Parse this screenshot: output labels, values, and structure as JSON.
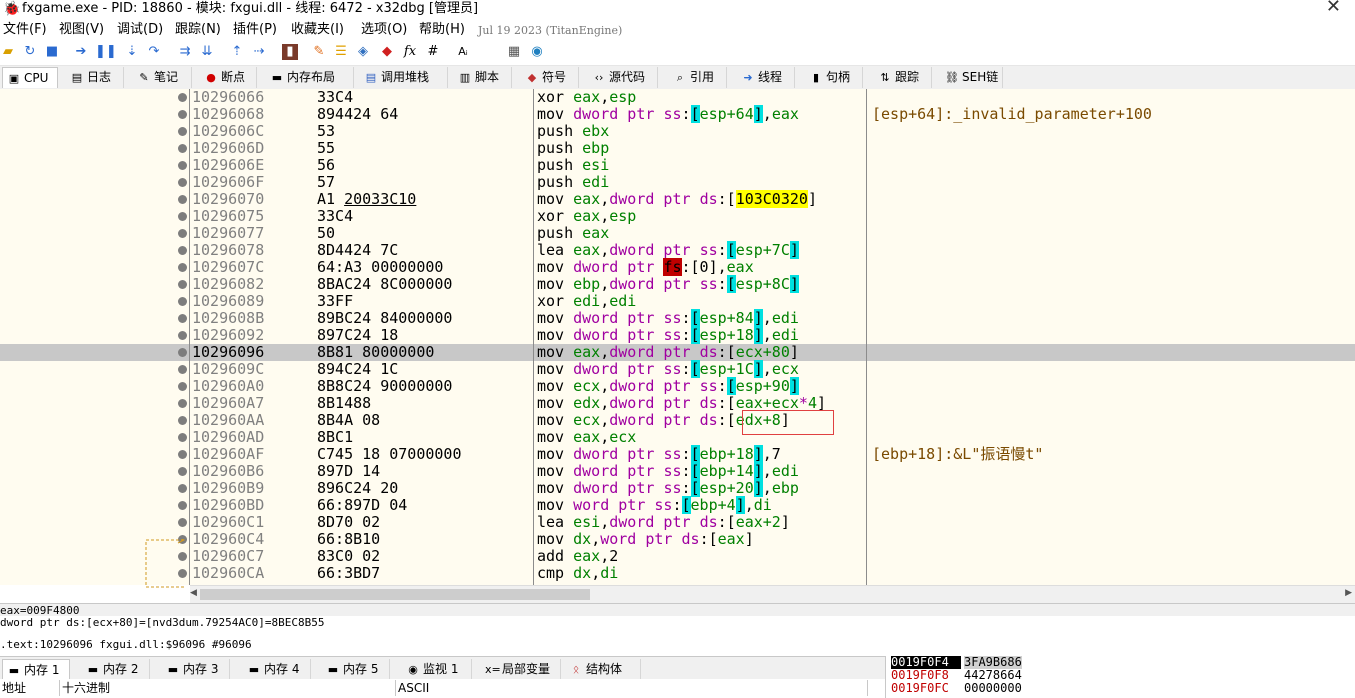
{
  "window": {
    "title": "fxgame.exe - PID: 18860 - 模块: fxgui.dll - 线程: 6472 - x32dbg [管理员]",
    "close": "✕"
  },
  "menu": {
    "items": [
      "文件(F)",
      "视图(V)",
      "调试(D)",
      "跟踪(N)",
      "插件(P)",
      "收藏夹(I)",
      "选项(O)",
      "帮助(H)"
    ],
    "build_date": "Jul 19 2023 (TitanEngine)"
  },
  "toolbar": {
    "icons": [
      "open-icon",
      "restart-icon",
      "stop-icon",
      "run-icon",
      "pause-icon",
      "step-into-icon",
      "step-over-icon",
      "trace-into-icon",
      "trace-over-icon",
      "execute-till-return-icon",
      "run-to-user-code-icon",
      "scylla-icon",
      "patch-icon",
      "comment-icon",
      "label-icon",
      "bookmark-icon",
      "function-icon",
      "hash-icon",
      "font-icon",
      "calculator-icon",
      "globe-icon"
    ]
  },
  "tabs": [
    {
      "label": "CPU",
      "icon": "cpu-icon"
    },
    {
      "label": "日志",
      "icon": "log-icon"
    },
    {
      "label": "笔记",
      "icon": "notes-icon"
    },
    {
      "label": "断点",
      "icon": "breakpoint-icon"
    },
    {
      "label": "内存布局",
      "icon": "memory-map-icon"
    },
    {
      "label": "调用堆栈",
      "icon": "call-stack-icon"
    },
    {
      "label": "脚本",
      "icon": "script-icon"
    },
    {
      "label": "符号",
      "icon": "symbols-icon"
    },
    {
      "label": "源代码",
      "icon": "source-icon"
    },
    {
      "label": "引用",
      "icon": "references-icon"
    },
    {
      "label": "线程",
      "icon": "threads-icon"
    },
    {
      "label": "句柄",
      "icon": "handles-icon"
    },
    {
      "label": "跟踪",
      "icon": "trace-icon"
    },
    {
      "label": "SEH链",
      "icon": "seh-icon"
    }
  ],
  "disasm": [
    {
      "addr": "10296066",
      "bytes": "33C4",
      "ins": [
        [
          "mn",
          "xor "
        ],
        [
          "rg",
          "eax"
        ],
        [
          "nm",
          ","
        ],
        [
          "rg",
          "esp"
        ]
      ],
      "cmt": ""
    },
    {
      "addr": "10296068",
      "bytes": "894424 64",
      "ins": [
        [
          "mn",
          "mov "
        ],
        [
          "kw",
          "dword ptr "
        ],
        [
          "sg",
          "ss"
        ],
        [
          "nm",
          ":"
        ],
        [
          "br",
          "["
        ],
        [
          "rg",
          "esp+64"
        ],
        [
          "br",
          "]"
        ],
        [
          "nm",
          ","
        ],
        [
          "rg",
          "eax"
        ]
      ],
      "cmt": "[esp+64]:_invalid_parameter+100"
    },
    {
      "addr": "1029606C",
      "bytes": "53",
      "ins": [
        [
          "mn",
          "push "
        ],
        [
          "rg",
          "ebx"
        ]
      ],
      "cmt": ""
    },
    {
      "addr": "1029606D",
      "bytes": "55",
      "ins": [
        [
          "mn",
          "push "
        ],
        [
          "rg",
          "ebp"
        ]
      ],
      "cmt": ""
    },
    {
      "addr": "1029606E",
      "bytes": "56",
      "ins": [
        [
          "mn",
          "push "
        ],
        [
          "rg",
          "esi"
        ]
      ],
      "cmt": ""
    },
    {
      "addr": "1029606F",
      "bytes": "57",
      "ins": [
        [
          "mn",
          "push "
        ],
        [
          "rg",
          "edi"
        ]
      ],
      "cmt": ""
    },
    {
      "addr": "10296070",
      "bytes": "A1 20033C10",
      "ul": "20033C10",
      "ins": [
        [
          "mn",
          "mov "
        ],
        [
          "rg",
          "eax"
        ],
        [
          "nm",
          ","
        ],
        [
          "kw",
          "dword ptr "
        ],
        [
          "sg",
          "ds"
        ],
        [
          "nm",
          ":["
        ],
        [
          "hl",
          "103C0320"
        ],
        [
          "nm",
          "]"
        ]
      ],
      "cmt": ""
    },
    {
      "addr": "10296075",
      "bytes": "33C4",
      "ins": [
        [
          "mn",
          "xor "
        ],
        [
          "rg",
          "eax"
        ],
        [
          "nm",
          ","
        ],
        [
          "rg",
          "esp"
        ]
      ],
      "cmt": ""
    },
    {
      "addr": "10296077",
      "bytes": "50",
      "ins": [
        [
          "mn",
          "push "
        ],
        [
          "rg",
          "eax"
        ]
      ],
      "cmt": ""
    },
    {
      "addr": "10296078",
      "bytes": "8D4424 7C",
      "ins": [
        [
          "mn",
          "lea "
        ],
        [
          "rg",
          "eax"
        ],
        [
          "nm",
          ","
        ],
        [
          "kw",
          "dword ptr "
        ],
        [
          "sg",
          "ss"
        ],
        [
          "nm",
          ":"
        ],
        [
          "br",
          "["
        ],
        [
          "rg",
          "esp+7C"
        ],
        [
          "br",
          "]"
        ]
      ],
      "cmt": ""
    },
    {
      "addr": "1029607C",
      "bytes": "64:A3 00000000",
      "ins": [
        [
          "mn",
          "mov "
        ],
        [
          "kw",
          "dword ptr "
        ],
        [
          "fs",
          "fs"
        ],
        [
          "nm",
          ":[0],"
        ],
        [
          "rg",
          "eax"
        ]
      ],
      "cmt": ""
    },
    {
      "addr": "10296082",
      "bytes": "8BAC24 8C000000",
      "ins": [
        [
          "mn",
          "mov "
        ],
        [
          "rg",
          "ebp"
        ],
        [
          "nm",
          ","
        ],
        [
          "kw",
          "dword ptr "
        ],
        [
          "sg",
          "ss"
        ],
        [
          "nm",
          ":"
        ],
        [
          "br",
          "["
        ],
        [
          "rg",
          "esp+8C"
        ],
        [
          "br",
          "]"
        ]
      ],
      "cmt": ""
    },
    {
      "addr": "10296089",
      "bytes": "33FF",
      "ins": [
        [
          "mn",
          "xor "
        ],
        [
          "rg",
          "edi"
        ],
        [
          "nm",
          ","
        ],
        [
          "rg",
          "edi"
        ]
      ],
      "cmt": ""
    },
    {
      "addr": "1029608B",
      "bytes": "89BC24 84000000",
      "ins": [
        [
          "mn",
          "mov "
        ],
        [
          "kw",
          "dword ptr "
        ],
        [
          "sg",
          "ss"
        ],
        [
          "nm",
          ":"
        ],
        [
          "br",
          "["
        ],
        [
          "rg",
          "esp+84"
        ],
        [
          "br",
          "]"
        ],
        [
          "nm",
          ","
        ],
        [
          "rg",
          "edi"
        ]
      ],
      "cmt": ""
    },
    {
      "addr": "10296092",
      "bytes": "897C24 18",
      "ins": [
        [
          "mn",
          "mov "
        ],
        [
          "kw",
          "dword ptr "
        ],
        [
          "sg",
          "ss"
        ],
        [
          "nm",
          ":"
        ],
        [
          "br",
          "["
        ],
        [
          "rg",
          "esp+18"
        ],
        [
          "br",
          "]"
        ],
        [
          "nm",
          ","
        ],
        [
          "rg",
          "edi"
        ]
      ],
      "cmt": ""
    },
    {
      "addr": "10296096",
      "bytes": "8B81 80000000",
      "sel": true,
      "ins": [
        [
          "mn",
          "mov "
        ],
        [
          "rg",
          "eax"
        ],
        [
          "nm",
          ","
        ],
        [
          "kw",
          "dword ptr "
        ],
        [
          "sg",
          "ds"
        ],
        [
          "nm",
          ":["
        ],
        [
          "rg",
          "ecx+80"
        ],
        [
          "nm",
          "]"
        ]
      ],
      "cmt": ""
    },
    {
      "addr": "1029609C",
      "bytes": "894C24 1C",
      "ins": [
        [
          "mn",
          "mov "
        ],
        [
          "kw",
          "dword ptr "
        ],
        [
          "sg",
          "ss"
        ],
        [
          "nm",
          ":"
        ],
        [
          "br",
          "["
        ],
        [
          "rg",
          "esp+1C"
        ],
        [
          "br",
          "]"
        ],
        [
          "nm",
          ","
        ],
        [
          "rg",
          "ecx"
        ]
      ],
      "cmt": ""
    },
    {
      "addr": "102960A0",
      "bytes": "8B8C24 90000000",
      "ins": [
        [
          "mn",
          "mov "
        ],
        [
          "rg",
          "ecx"
        ],
        [
          "nm",
          ","
        ],
        [
          "kw",
          "dword ptr "
        ],
        [
          "sg",
          "ss"
        ],
        [
          "nm",
          ":"
        ],
        [
          "br",
          "["
        ],
        [
          "rg",
          "esp+90"
        ],
        [
          "br",
          "]"
        ]
      ],
      "cmt": ""
    },
    {
      "addr": "102960A7",
      "bytes": "8B1488",
      "ins": [
        [
          "mn",
          "mov "
        ],
        [
          "rg",
          "edx"
        ],
        [
          "nm",
          ","
        ],
        [
          "kw",
          "dword ptr "
        ],
        [
          "sg",
          "ds"
        ],
        [
          "nm",
          ":["
        ],
        [
          "rg",
          "eax+ecx"
        ],
        [
          "kw",
          "*"
        ],
        [
          "rg",
          "4"
        ],
        [
          "nm",
          "]"
        ]
      ],
      "cmt": ""
    },
    {
      "addr": "102960AA",
      "bytes": "8B4A 08",
      "ins": [
        [
          "mn",
          "mov "
        ],
        [
          "rg",
          "ecx"
        ],
        [
          "nm",
          ","
        ],
        [
          "kw",
          "dword ptr "
        ],
        [
          "sg",
          "ds"
        ],
        [
          "nm",
          ":["
        ],
        [
          "rg",
          "edx+8"
        ],
        [
          "nm",
          "]"
        ]
      ],
      "cmt": ""
    },
    {
      "addr": "102960AD",
      "bytes": "8BC1",
      "ins": [
        [
          "mn",
          "mov "
        ],
        [
          "rg",
          "eax"
        ],
        [
          "nm",
          ","
        ],
        [
          "rg",
          "ecx"
        ]
      ],
      "cmt": ""
    },
    {
      "addr": "102960AF",
      "bytes": "C745 18 07000000",
      "ins": [
        [
          "mn",
          "mov "
        ],
        [
          "kw",
          "dword ptr "
        ],
        [
          "sg",
          "ss"
        ],
        [
          "nm",
          ":"
        ],
        [
          "br",
          "["
        ],
        [
          "rg",
          "ebp+18"
        ],
        [
          "br",
          "]"
        ],
        [
          "nm",
          ",7"
        ]
      ],
      "cmt": "[ebp+18]:&L\"振语慢t\""
    },
    {
      "addr": "102960B6",
      "bytes": "897D 14",
      "ins": [
        [
          "mn",
          "mov "
        ],
        [
          "kw",
          "dword ptr "
        ],
        [
          "sg",
          "ss"
        ],
        [
          "nm",
          ":"
        ],
        [
          "br",
          "["
        ],
        [
          "rg",
          "ebp+14"
        ],
        [
          "br",
          "]"
        ],
        [
          "nm",
          ","
        ],
        [
          "rg",
          "edi"
        ]
      ],
      "cmt": ""
    },
    {
      "addr": "102960B9",
      "bytes": "896C24 20",
      "ins": [
        [
          "mn",
          "mov "
        ],
        [
          "kw",
          "dword ptr "
        ],
        [
          "sg",
          "ss"
        ],
        [
          "nm",
          ":"
        ],
        [
          "br",
          "["
        ],
        [
          "rg",
          "esp+20"
        ],
        [
          "br",
          "]"
        ],
        [
          "nm",
          ","
        ],
        [
          "rg",
          "ebp"
        ]
      ],
      "cmt": ""
    },
    {
      "addr": "102960BD",
      "bytes": "66:897D 04",
      "ins": [
        [
          "mn",
          "mov "
        ],
        [
          "kw",
          "word ptr "
        ],
        [
          "sg",
          "ss"
        ],
        [
          "nm",
          ":"
        ],
        [
          "br",
          "["
        ],
        [
          "rg",
          "ebp+4"
        ],
        [
          "br",
          "]"
        ],
        [
          "nm",
          ","
        ],
        [
          "rg",
          "di"
        ]
      ],
      "cmt": ""
    },
    {
      "addr": "102960C1",
      "bytes": "8D70 02",
      "ins": [
        [
          "mn",
          "lea "
        ],
        [
          "rg",
          "esi"
        ],
        [
          "nm",
          ","
        ],
        [
          "kw",
          "dword ptr "
        ],
        [
          "sg",
          "ds"
        ],
        [
          "nm",
          ":["
        ],
        [
          "rg",
          "eax+2"
        ],
        [
          "nm",
          "]"
        ]
      ],
      "cmt": ""
    },
    {
      "addr": "102960C4",
      "bytes": "66:8B10",
      "ins": [
        [
          "mn",
          "mov "
        ],
        [
          "rg",
          "dx"
        ],
        [
          "nm",
          ","
        ],
        [
          "kw",
          "word ptr "
        ],
        [
          "sg",
          "ds"
        ],
        [
          "nm",
          ":["
        ],
        [
          "rg",
          "eax"
        ],
        [
          "nm",
          "]"
        ]
      ],
      "cmt": ""
    },
    {
      "addr": "102960C7",
      "bytes": "83C0 02",
      "ins": [
        [
          "mn",
          "add "
        ],
        [
          "rg",
          "eax"
        ],
        [
          "nm",
          ",2"
        ]
      ],
      "cmt": ""
    },
    {
      "addr": "102960CA",
      "bytes": "66:3BD7",
      "ins": [
        [
          "mn",
          "cmp "
        ],
        [
          "rg",
          "dx"
        ],
        [
          "nm",
          ","
        ],
        [
          "rg",
          "di"
        ]
      ],
      "cmt": ""
    }
  ],
  "info": {
    "line1": "eax=009F4800",
    "line2": "dword ptr ds:[ecx+80]=[nvd3dum.79254AC0]=8BEC8B55",
    "line3": ".text:10296096 fxgui.dll:$96096 #96096"
  },
  "bottom_tabs": [
    {
      "label": "内存 1",
      "icon": "dump-icon"
    },
    {
      "label": "内存 2",
      "icon": "dump-icon"
    },
    {
      "label": "内存 3",
      "icon": "dump-icon"
    },
    {
      "label": "内存 4",
      "icon": "dump-icon"
    },
    {
      "label": "内存 5",
      "icon": "dump-icon"
    },
    {
      "label": "监视 1",
      "icon": "watch-icon"
    },
    {
      "label": "局部变量",
      "icon": "locals-icon"
    },
    {
      "label": "结构体",
      "icon": "struct-icon"
    }
  ],
  "dump_header": {
    "addr": "地址",
    "hex": "十六进制",
    "ascii": "ASCII"
  },
  "stack": [
    {
      "addr": "0019F0F4",
      "val": "3FA9B686",
      "sel": true
    },
    {
      "addr": "0019F0F8",
      "val": "44278664"
    },
    {
      "addr": "0019F0FC",
      "val": "00000000"
    }
  ],
  "colors": {
    "disasm_bg": "#fffcf0",
    "selection": "#c8c8c8",
    "bracket_hl": "#00e0e0",
    "addr_hl": "#ffff00",
    "register": "#008000",
    "keyword": "#a000a0"
  }
}
